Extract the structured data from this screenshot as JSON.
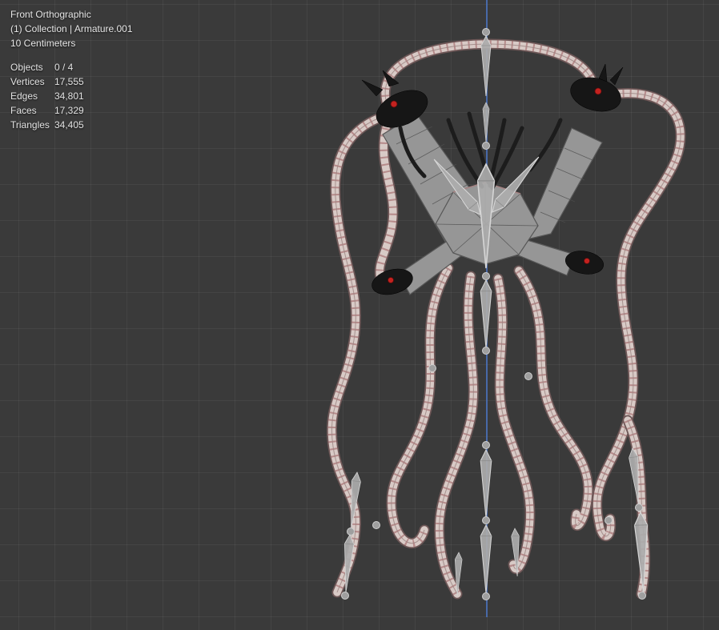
{
  "header": {
    "view": "Front Orthographic",
    "collection": "(1) Collection | Armature.001",
    "scale": "10 Centimeters"
  },
  "stats": {
    "rows": [
      {
        "label": "Objects",
        "value": "0 / 4"
      },
      {
        "label": "Vertices",
        "value": "17,555"
      },
      {
        "label": "Edges",
        "value": "34,801"
      },
      {
        "label": "Faces",
        "value": "17,329"
      },
      {
        "label": "Triangles",
        "value": "34,405"
      }
    ]
  },
  "colors": {
    "viewport_background": "#3a3a3a",
    "grid_line": "#454545",
    "z_axis": "#4a6fb5",
    "tentacle_outline": "#6e5757",
    "tentacle_fill": "#d8cac6",
    "tentacle_band": "#b08080",
    "bone": "#adadad",
    "marker_red": "#c4221f",
    "overlay_text": "#e6e6e6"
  }
}
